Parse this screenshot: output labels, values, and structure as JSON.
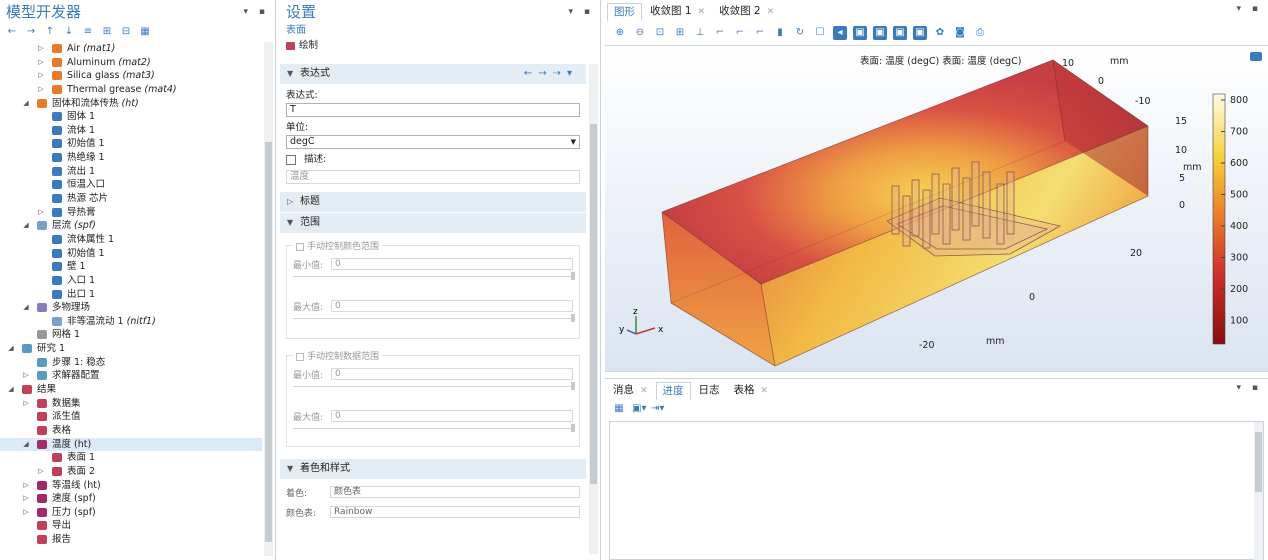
{
  "model_builder": {
    "title": "模型开发器",
    "toolbar_icons": [
      "arrow-left-icon",
      "arrow-right-icon",
      "arrow-up-icon",
      "arrow-down-icon",
      "filter-icon",
      "expand-icon",
      "collapse-icon",
      "list-menu-icon"
    ],
    "tree": [
      {
        "label": "Air",
        "tag": "(mat1)",
        "level": 4,
        "icon": "material-icon",
        "caret": "collapsed"
      },
      {
        "label": "Aluminum",
        "tag": "(mat2)",
        "level": 4,
        "icon": "material-icon",
        "caret": "collapsed"
      },
      {
        "label": "Silica glass",
        "tag": "(mat3)",
        "level": 4,
        "icon": "material-icon",
        "caret": "collapsed"
      },
      {
        "label": "Thermal grease",
        "tag": "(mat4)",
        "level": 4,
        "icon": "material-icon",
        "caret": "collapsed"
      },
      {
        "label": "固体和流体传热",
        "tag": "(ht)",
        "level": 3,
        "icon": "heat-transfer-icon",
        "caret": "expanded"
      },
      {
        "label": "固体 1",
        "tag": "",
        "level": 4,
        "icon": "feature-icon",
        "caret": ""
      },
      {
        "label": "流体 1",
        "tag": "",
        "level": 4,
        "icon": "feature-icon",
        "caret": ""
      },
      {
        "label": "初始值 1",
        "tag": "",
        "level": 4,
        "icon": "feature-icon",
        "caret": ""
      },
      {
        "label": "热绝缘 1",
        "tag": "",
        "level": 4,
        "icon": "feature-icon",
        "caret": ""
      },
      {
        "label": "流出 1",
        "tag": "",
        "level": 4,
        "icon": "feature-icon",
        "caret": ""
      },
      {
        "label": "恒温入口",
        "tag": "",
        "level": 4,
        "icon": "feature-icon",
        "caret": ""
      },
      {
        "label": "热源 芯片",
        "tag": "",
        "level": 4,
        "icon": "feature-icon",
        "caret": ""
      },
      {
        "label": "导热膏",
        "tag": "",
        "level": 4,
        "icon": "feature-icon",
        "caret": "collapsed"
      },
      {
        "label": "层流",
        "tag": "(spf)",
        "level": 3,
        "icon": "laminar-flow-icon",
        "caret": "expanded"
      },
      {
        "label": "流体属性 1",
        "tag": "",
        "level": 4,
        "icon": "feature-icon",
        "caret": ""
      },
      {
        "label": "初始值 1",
        "tag": "",
        "level": 4,
        "icon": "feature-icon",
        "caret": ""
      },
      {
        "label": "壁 1",
        "tag": "",
        "level": 4,
        "icon": "feature-icon",
        "caret": ""
      },
      {
        "label": "入口 1",
        "tag": "",
        "level": 4,
        "icon": "feature-icon",
        "caret": ""
      },
      {
        "label": "出口 1",
        "tag": "",
        "level": 4,
        "icon": "feature-icon",
        "caret": ""
      },
      {
        "label": "多物理场",
        "tag": "",
        "level": 3,
        "icon": "multiphysics-icon",
        "caret": "expanded"
      },
      {
        "label": "非等温流动 1",
        "tag": "(nitf1)",
        "level": 4,
        "icon": "coupling-icon",
        "caret": ""
      },
      {
        "label": "网格 1",
        "tag": "",
        "level": 3,
        "icon": "mesh-icon",
        "caret": ""
      },
      {
        "label": "研究 1",
        "tag": "",
        "level": 2,
        "icon": "study-icon",
        "caret": "expanded"
      },
      {
        "label": "步骤 1: 稳态",
        "tag": "",
        "level": 3,
        "icon": "study-step-icon",
        "caret": ""
      },
      {
        "label": "求解器配置",
        "tag": "",
        "level": 3,
        "icon": "solver-icon",
        "caret": "collapsed"
      },
      {
        "label": "结果",
        "tag": "",
        "level": 2,
        "icon": "results-icon",
        "caret": "expanded"
      },
      {
        "label": "数据集",
        "tag": "",
        "level": 3,
        "icon": "dataset-icon",
        "caret": "collapsed"
      },
      {
        "label": "派生值",
        "tag": "",
        "level": 3,
        "icon": "derived-values-icon",
        "caret": ""
      },
      {
        "label": "表格",
        "tag": "",
        "level": 3,
        "icon": "table-icon",
        "caret": ""
      },
      {
        "label": "温度 (ht)",
        "tag": "",
        "level": 3,
        "icon": "plot-group-icon",
        "caret": "expanded",
        "selected": true
      },
      {
        "label": "表面 1",
        "tag": "",
        "level": 4,
        "icon": "surface-plot-icon",
        "caret": ""
      },
      {
        "label": "表面 2",
        "tag": "",
        "level": 4,
        "icon": "surface-plot-icon",
        "caret": "collapsed"
      },
      {
        "label": "等温线 (ht)",
        "tag": "",
        "level": 3,
        "icon": "plot-group-icon",
        "caret": "collapsed"
      },
      {
        "label": "速度 (spf)",
        "tag": "",
        "level": 3,
        "icon": "plot-group-icon",
        "caret": "collapsed"
      },
      {
        "label": "压力 (spf)",
        "tag": "",
        "level": 3,
        "icon": "plot-group-icon",
        "caret": "collapsed"
      },
      {
        "label": "导出",
        "tag": "",
        "level": 3,
        "icon": "export-icon",
        "caret": ""
      },
      {
        "label": "报告",
        "tag": "",
        "level": 3,
        "icon": "report-icon",
        "caret": ""
      }
    ]
  },
  "settings": {
    "title": "设置",
    "subtitle": "表面",
    "plot_button": "绘制",
    "expression_section": "表达式",
    "expression_label": "表达式:",
    "expression_value": "T",
    "unit_label": "单位:",
    "unit_value": "degC",
    "description_label": "描述:",
    "description_value": "温度",
    "title_section": "标题",
    "range_section": "范围",
    "manual_color_range": "手动控制颜色范围",
    "manual_data_range": "手动控制数据范围",
    "min_label": "最小值:",
    "max_label": "最大值:",
    "color_min": "0",
    "color_max": "0",
    "data_min": "0",
    "data_max": "0",
    "coloring_section": "着色和样式",
    "coloring_label": "着色:",
    "coloring_value": "颜色表",
    "colortable_label": "颜色表:",
    "colortable_value": "Rainbow"
  },
  "graphics": {
    "tabs": [
      {
        "label": "图形",
        "closable": false,
        "active": true
      },
      {
        "label": "收敛图 1",
        "closable": true,
        "active": false
      },
      {
        "label": "收敛图 2",
        "closable": true,
        "active": false
      }
    ],
    "plot_title": "表面: 温度 (degC)  表面: 温度 (degC)",
    "axis_unit": "mm",
    "y_ticks": [
      "10",
      "0",
      "-10"
    ],
    "z_ticks": [
      "15",
      "10",
      "5",
      "0"
    ],
    "x_ticks": [
      "20",
      "0",
      "-20"
    ],
    "triad": {
      "z": "z",
      "y": "y",
      "x": "x"
    },
    "colorbar_ticks": [
      "800",
      "700",
      "600",
      "500",
      "400",
      "300",
      "200",
      "100"
    ],
    "colors": {
      "hot": "#fff4a0",
      "warm": "#f4b93a",
      "mid": "#e26a2c",
      "cool": "#c42a22",
      "cold": "#8a0c10"
    }
  },
  "bottom": {
    "tabs": [
      {
        "label": "消息",
        "closable": true,
        "active": false
      },
      {
        "label": "进度",
        "closable": false,
        "active": true
      },
      {
        "label": "日志",
        "closable": false,
        "active": false
      },
      {
        "label": "表格",
        "closable": true,
        "active": false
      }
    ]
  }
}
